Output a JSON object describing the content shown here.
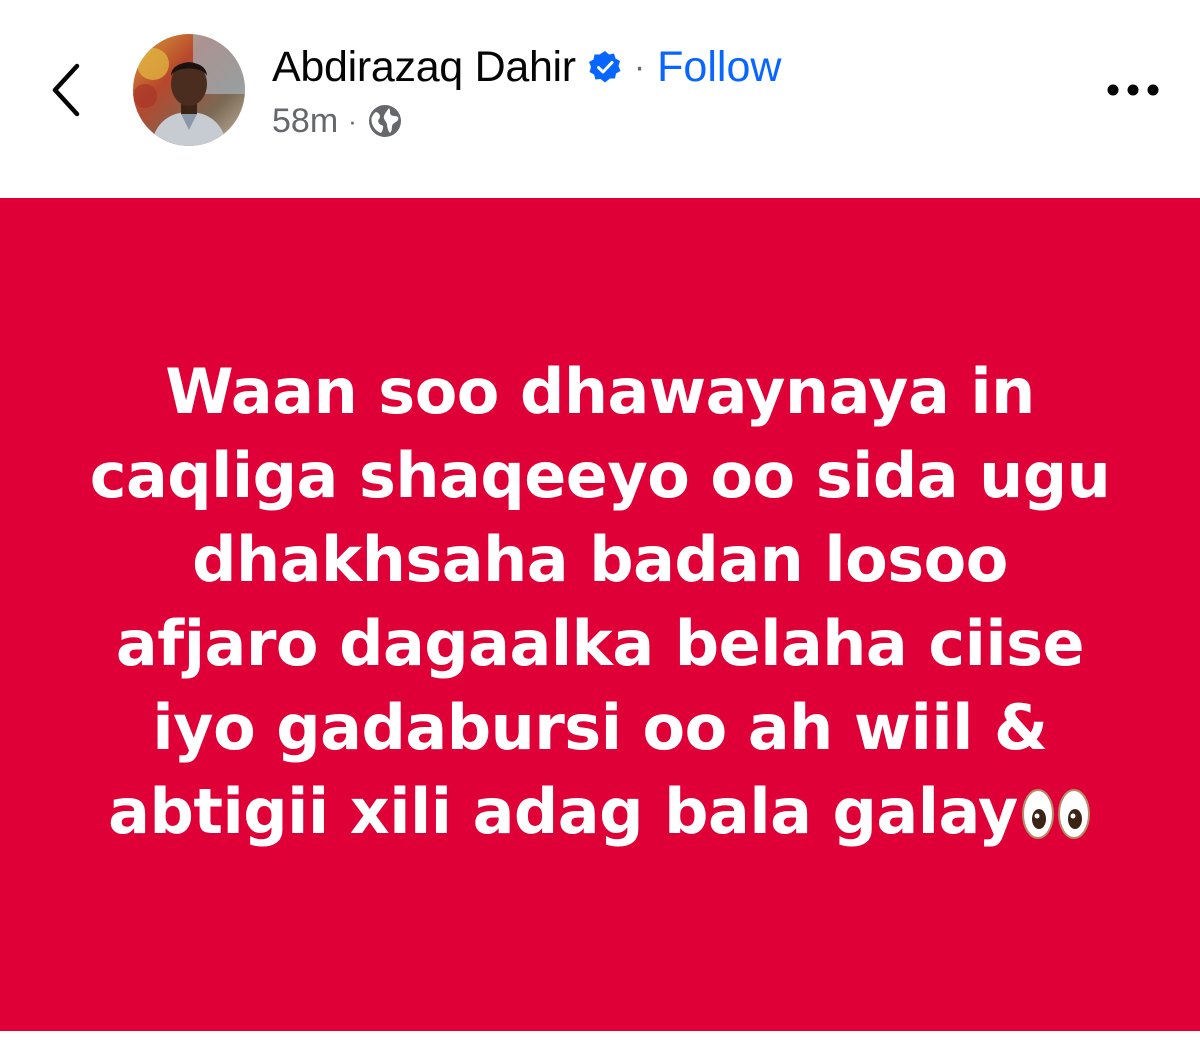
{
  "header": {
    "author_name": "Abdirazaq Dahir",
    "separator": "·",
    "follow_label": "Follow",
    "timestamp": "58m",
    "meta_separator": "·",
    "privacy_icon": "globe-icon",
    "back_icon": "chevron-left-icon",
    "more_icon": "more-horizontal-icon",
    "verified_icon": "verified-badge-icon"
  },
  "post": {
    "background_color": "#de0036",
    "text_color": "#ffffff",
    "lines": [
      "Waan soo dhawaynaya in",
      "caqliga shaqeeyo oo sida ugu",
      "dhakhsaha badan losoo",
      "afjaro dagaalka belaha ciise",
      "iyo gadabursi oo ah wiil &",
      "abtigii xili adag bala galay"
    ],
    "trailing_emoji": "eyes-emoji"
  },
  "colors": {
    "follow": "#0866ff",
    "secondary_text": "#65676b",
    "verified": "#0866ff"
  }
}
